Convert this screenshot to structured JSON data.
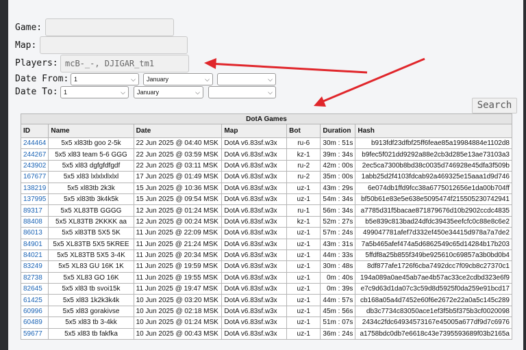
{
  "form": {
    "game_label": "Game:",
    "map_label": "Map:",
    "players_label": "Players:",
    "players_value": "mcB-_-, DJIGAR_tm1",
    "date_from_label": "Date From:",
    "date_to_label": "Date To:",
    "date_from": {
      "day": "1",
      "month": "January",
      "year": ""
    },
    "date_to": {
      "day": "1",
      "month": "January",
      "year": ""
    },
    "search_label": "Search"
  },
  "table": {
    "caption": "DotA Games",
    "headers": [
      "ID",
      "Name",
      "Date",
      "Map",
      "Bot",
      "Duration",
      "Hash"
    ],
    "rows": [
      [
        "244464",
        "5x5 xl83tb goo 2-5k",
        "22 Jun 2025 @ 04:40 MSK",
        "DotA v6.83sf.w3x",
        "ru-6",
        "30m : 51s",
        "b913fdf23dfbf25ff6feae85a19984884e1102d8"
      ],
      [
        "244267",
        "5x5 xl83 team 5-6 GGG",
        "22 Jun 2025 @ 03:59 MSK",
        "DotA v6.83sf.w3x",
        "kz-1",
        "39m : 34s",
        "b9fec5f021dd9292a88e2cb3d285e13ae73103a3"
      ],
      [
        "243902",
        "5x5 xl83 dgfgfdfgdf",
        "22 Jun 2025 @ 03:11 MSK",
        "DotA v6.83sf.w3x",
        "ru-2",
        "42m : 00s",
        "2ec5ca7300b8bd38c0035d746928e45dfa3f509b"
      ],
      [
        "167677",
        "5x5 xl83 lxlxlxllxlxl",
        "17 Jun 2025 @ 01:49 MSK",
        "DotA v6.83sf.w3x",
        "ru-2",
        "35m : 00s",
        "1abb25d2f4103fdcab92a469325e15aaa1d9d746"
      ],
      [
        "138219",
        "5x5 xl83tb 2k3k",
        "15 Jun 2025 @ 10:36 MSK",
        "DotA v6.83sf.w3x",
        "uz-1",
        "43m : 29s",
        "6e074db1ffd9fcc38a6775012656e1da00b704ff"
      ],
      [
        "137995",
        "5x5 xl83tb 3k4k5k",
        "15 Jun 2025 @ 09:54 MSK",
        "DotA v6.83sf.w3x",
        "uz-1",
        "54m : 34s",
        "bf50b61e83e5e638e5095474f215505230742941"
      ],
      [
        "89317",
        "5x5 XL83TB GGGG",
        "12 Jun 2025 @ 01:24 MSK",
        "DotA v6.83sf.w3x",
        "ru-1",
        "56m : 34s",
        "a7785d31f5bacae871879676d10b2902ccdc4835"
      ],
      [
        "88408",
        "5x5 XL83TB 2KKKK aa",
        "12 Jun 2025 @ 00:24 MSK",
        "DotA v6.83sf.w3x",
        "kz-1",
        "52m : 27s",
        "b5e839c813bad24dfdc39435eefcfc0c88e8c6e2"
      ],
      [
        "86013",
        "5x5 xl83TB 5X5 5K",
        "11 Jun 2025 @ 22:09 MSK",
        "DotA v6.83sf.w3x",
        "uz-1",
        "57m : 24s",
        "499047781afef7d332ef450e34415d978a7a7de2"
      ],
      [
        "84901",
        "5x5 XL83TB 5X5 5KREE",
        "11 Jun 2025 @ 21:24 MSK",
        "DotA v6.83sf.w3x",
        "uz-1",
        "43m : 31s",
        "7a5b465afef474a5d6862549c65d14284b17b203"
      ],
      [
        "84021",
        "5x5 XL83TB 5X5 3-4K",
        "11 Jun 2025 @ 20:34 MSK",
        "DotA v6.83sf.w3x",
        "uz-1",
        "44m : 33s",
        "5ffdf8a25b855f349be925610c69857a3b0bd0b4"
      ],
      [
        "83249",
        "5x5 XL83 GU 16K 1K",
        "11 Jun 2025 @ 19:59 MSK",
        "DotA v6.83sf.w3x",
        "uz-1",
        "30m : 48s",
        "8df877afe1726f6cba7492dcc7f09cb8c27370c1"
      ],
      [
        "82738",
        "5x5 XL83 GO 16K",
        "11 Jun 2025 @ 19:55 MSK",
        "DotA v6.83sf.w3x",
        "uz-1",
        "0m : 40s",
        "194a089a0ae45ab7ae4b57ac33ce2cdbd323e6f9"
      ],
      [
        "82645",
        "5x5 xl83 tb svoi15k",
        "11 Jun 2025 @ 19:47 MSK",
        "DotA v6.83sf.w3x",
        "uz-1",
        "0m : 39s",
        "e7c9d63d1da07c3c59d8d5925f0da259e91bcd17"
      ],
      [
        "61425",
        "5x5 xl83 1k2k3k4k",
        "10 Jun 2025 @ 03:20 MSK",
        "DotA v6.83sf.w3x",
        "uz-1",
        "44m : 57s",
        "cb168a05a4d7452e60f6e2672e22a0a5c145c289"
      ],
      [
        "60996",
        "5x5 xl83 gorakivse",
        "10 Jun 2025 @ 02:18 MSK",
        "DotA v6.83sf.w3x",
        "uz-1",
        "45m : 56s",
        "db3c7734c83050ace1ef3f5b5f375b3cf0020098"
      ],
      [
        "60489",
        "5x5 xl83 tb 3-4kk",
        "10 Jun 2025 @ 01:24 MSK",
        "DotA v6.83sf.w3x",
        "uz-1",
        "51m : 07s",
        "2434c2fdc64934573167e45005a677df9d7c6976"
      ],
      [
        "59677",
        "5x5 xl83 tb fakfka",
        "10 Jun 2025 @ 00:43 MSK",
        "DotA v6.83sf.w3x",
        "uz-1",
        "36m : 24s",
        "a1758bdc0db7e6618c43e7395593689f03b2165a"
      ]
    ]
  },
  "colors": {
    "annotation_arrow": "#e0262b",
    "id_link": "#1a63b5"
  }
}
